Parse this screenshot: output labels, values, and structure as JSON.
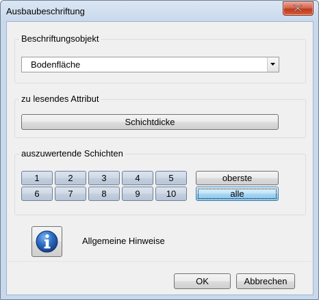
{
  "window": {
    "title": "Ausbaubeschriftung"
  },
  "groups": {
    "beschriftungsobjekt": {
      "label": "Beschriftungsobjekt",
      "selected": "Bodenfläche"
    },
    "attribut": {
      "label": "zu lesendes Attribut",
      "button": "Schichtdicke"
    },
    "schichten": {
      "label": "auszuwertende Schichten",
      "row1": [
        "1",
        "2",
        "3",
        "4",
        "5"
      ],
      "row2": [
        "6",
        "7",
        "8",
        "9",
        "10"
      ],
      "oberste": "oberste",
      "alle": "alle"
    }
  },
  "info": {
    "label": "Allgemeine Hinweise"
  },
  "footer": {
    "ok": "OK",
    "cancel": "Abbrechen"
  },
  "icons": {
    "close": "close-icon",
    "dropdown": "chevron-down-icon",
    "info": "info-icon"
  }
}
